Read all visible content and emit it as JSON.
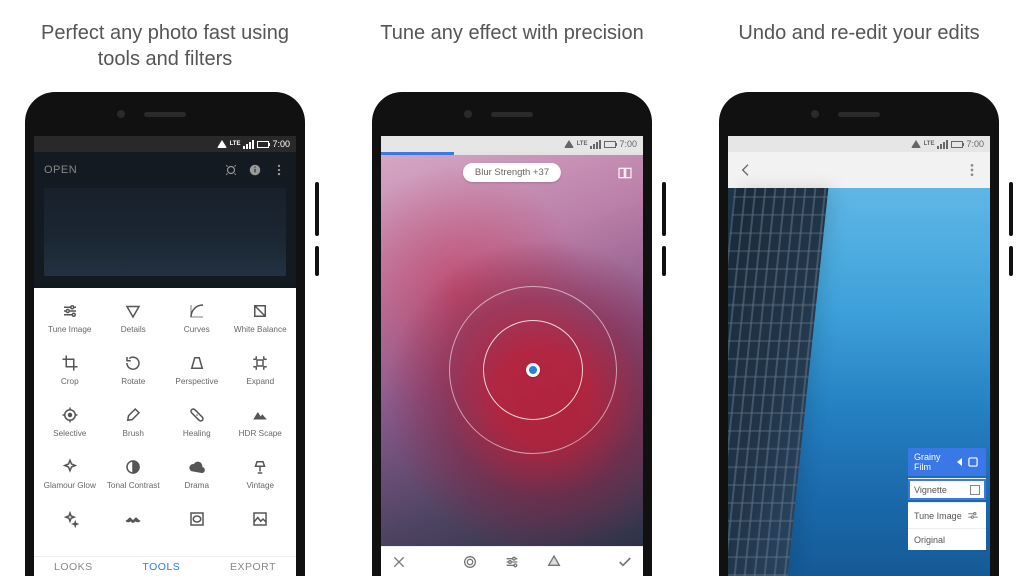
{
  "captions": {
    "c1": "Perfect any photo fast using tools and filters",
    "c2": "Tune any effect with precision",
    "c3": "Undo and re-edit your edits"
  },
  "status": {
    "time": "7:00",
    "net": "LTE"
  },
  "screen1": {
    "open_label": "OPEN",
    "tools": [
      "Tune Image",
      "Details",
      "Curves",
      "White Balance",
      "Crop",
      "Rotate",
      "Perspective",
      "Expand",
      "Selective",
      "Brush",
      "Healing",
      "HDR Scape",
      "Glamour Glow",
      "Tonal Contrast",
      "Drama",
      "Vintage"
    ],
    "row5_icons": [
      "sparkle",
      "mustache",
      "vignette-sq",
      "image-frame"
    ],
    "tabs": {
      "looks": "LOOKS",
      "tools": "TOOLS",
      "export": "EXPORT"
    }
  },
  "screen2": {
    "chip_label": "Blur Strength",
    "chip_value": "+37",
    "bottom_icons": [
      "close",
      "auto",
      "tune",
      "style",
      "check"
    ]
  },
  "screen3": {
    "stack_header": "Grainy Film",
    "stack_items": [
      "Vignette",
      "Tune Image",
      "Original"
    ],
    "selected_index": 0
  }
}
